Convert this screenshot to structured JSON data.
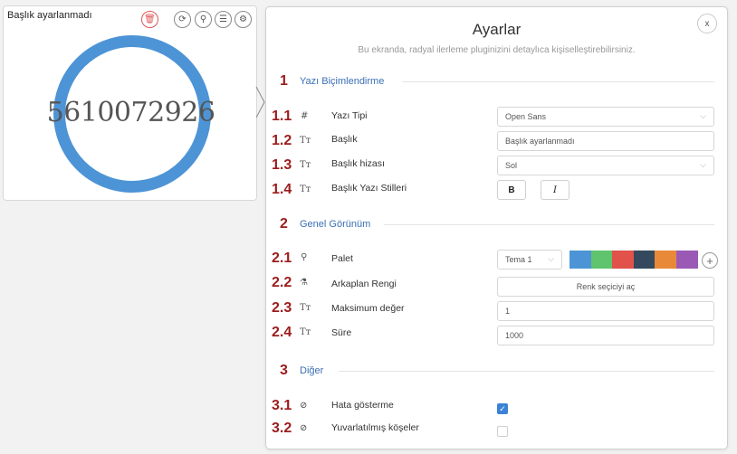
{
  "widget": {
    "title": "Başlık ayarlanmadı",
    "value": "5610072926",
    "tools": [
      "trash-icon",
      "refresh-icon",
      "key-icon",
      "list-icon",
      "gear-icon"
    ]
  },
  "panel": {
    "title": "Ayarlar",
    "subtitle": "Bu ekranda, radyal ilerleme pluginizini detaylıca kişiselleştirebilirsiniz.",
    "close_label": "x",
    "sections": [
      {
        "num": "1",
        "title": "Yazı Biçimlendirme"
      },
      {
        "num": "2",
        "title": "Genel Görünüm"
      },
      {
        "num": "3",
        "title": "Diğer"
      }
    ],
    "rows": {
      "r11": {
        "num": "1.1",
        "icon": "#",
        "label": "Yazı Tipi",
        "value": "Open Sans"
      },
      "r12": {
        "num": "1.2",
        "icon": "Tт",
        "label": "Başlık",
        "value": "Başlık ayarlanmadı"
      },
      "r13": {
        "num": "1.3",
        "icon": "Tт",
        "label": "Başlık hizası",
        "value": "Sol"
      },
      "r14": {
        "num": "1.4",
        "icon": "Tт",
        "label": "Başlık Yazı Stilleri",
        "bold": "B",
        "italic": "I"
      },
      "r21": {
        "num": "2.1",
        "icon": "⚲",
        "label": "Palet",
        "value": "Tema 1",
        "add": "+"
      },
      "r22": {
        "num": "2.2",
        "icon": "⚗",
        "label": "Arkaplan Rengi",
        "value": "Renk seçiciyi aç"
      },
      "r23": {
        "num": "2.3",
        "icon": "Tт",
        "label": "Maksimum değer",
        "value": "1"
      },
      "r24": {
        "num": "2.4",
        "icon": "Tт",
        "label": "Süre",
        "value": "1000"
      },
      "r31": {
        "num": "3.1",
        "icon": "⊘",
        "label": "Hata gösterme",
        "checked": true
      },
      "r32": {
        "num": "3.2",
        "icon": "⊘",
        "label": "Yuvarlatılmış köşeler",
        "checked": false
      }
    },
    "palette": [
      "#4d94d6",
      "#5fc46d",
      "#e0524a",
      "#34495e",
      "#e8893a",
      "#9b59b6"
    ]
  },
  "colors": {
    "accent": "#3b82d6",
    "section_title": "#3a6fb5",
    "number": "#9b1c1c"
  }
}
